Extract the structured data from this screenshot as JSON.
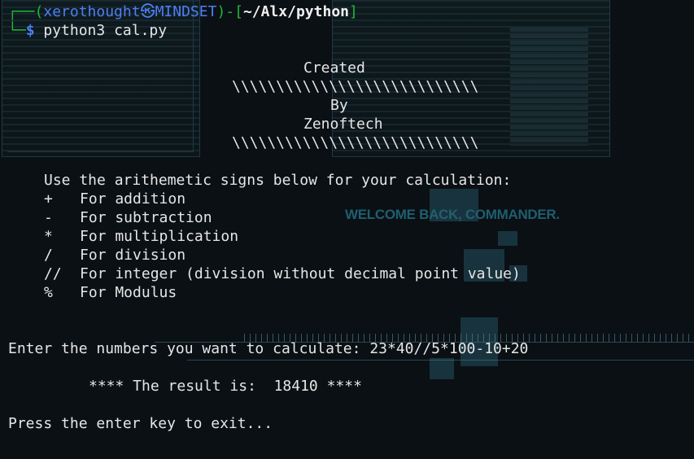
{
  "prompt": {
    "bracket_open": "┌──(",
    "user": "xerothought",
    "separator_icon": "㉿",
    "host": "MINDSET",
    "bracket_close": ")-[",
    "path": "~/Alx/python",
    "path_close": "]",
    "second_prefix": "└─",
    "dollar": "$",
    "command": "python3 cal.py"
  },
  "banner": {
    "created": "Created",
    "slashes_1": "\\\\\\\\\\\\\\\\\\\\\\\\\\\\\\\\\\\\\\\\\\\\\\\\\\\\\\\\",
    "by": "By",
    "author": "Zenoftech",
    "slashes_2": "\\\\\\\\\\\\\\\\\\\\\\\\\\\\\\\\\\\\\\\\\\\\\\\\\\\\\\\\"
  },
  "instructions": {
    "heading": "Use the arithemetic signs below for your calculation:",
    "items": [
      {
        "sign": "+",
        "label": "For addition"
      },
      {
        "sign": "-",
        "label": "For subtraction"
      },
      {
        "sign": "*",
        "label": "For multiplication"
      },
      {
        "sign": "/",
        "label": "For division"
      },
      {
        "sign": "//",
        "label": "For integer (division without decimal point value)"
      },
      {
        "sign": "%",
        "label": "For Modulus"
      }
    ]
  },
  "input": {
    "prompt": "Enter the numbers you want to calculate: ",
    "value": "23*40//5*100-10+20"
  },
  "result": {
    "text": "**** The result is:  18410 ****"
  },
  "exit": {
    "text": "Press the enter key to exit..."
  },
  "wallpaper": {
    "caption": "WELCOME BACK, COMMANDER."
  },
  "colors": {
    "prompt_green": "#1fb83a",
    "prompt_blue": "#4d7ef2",
    "text": "#e6e6e6",
    "background": "#0b1014"
  }
}
